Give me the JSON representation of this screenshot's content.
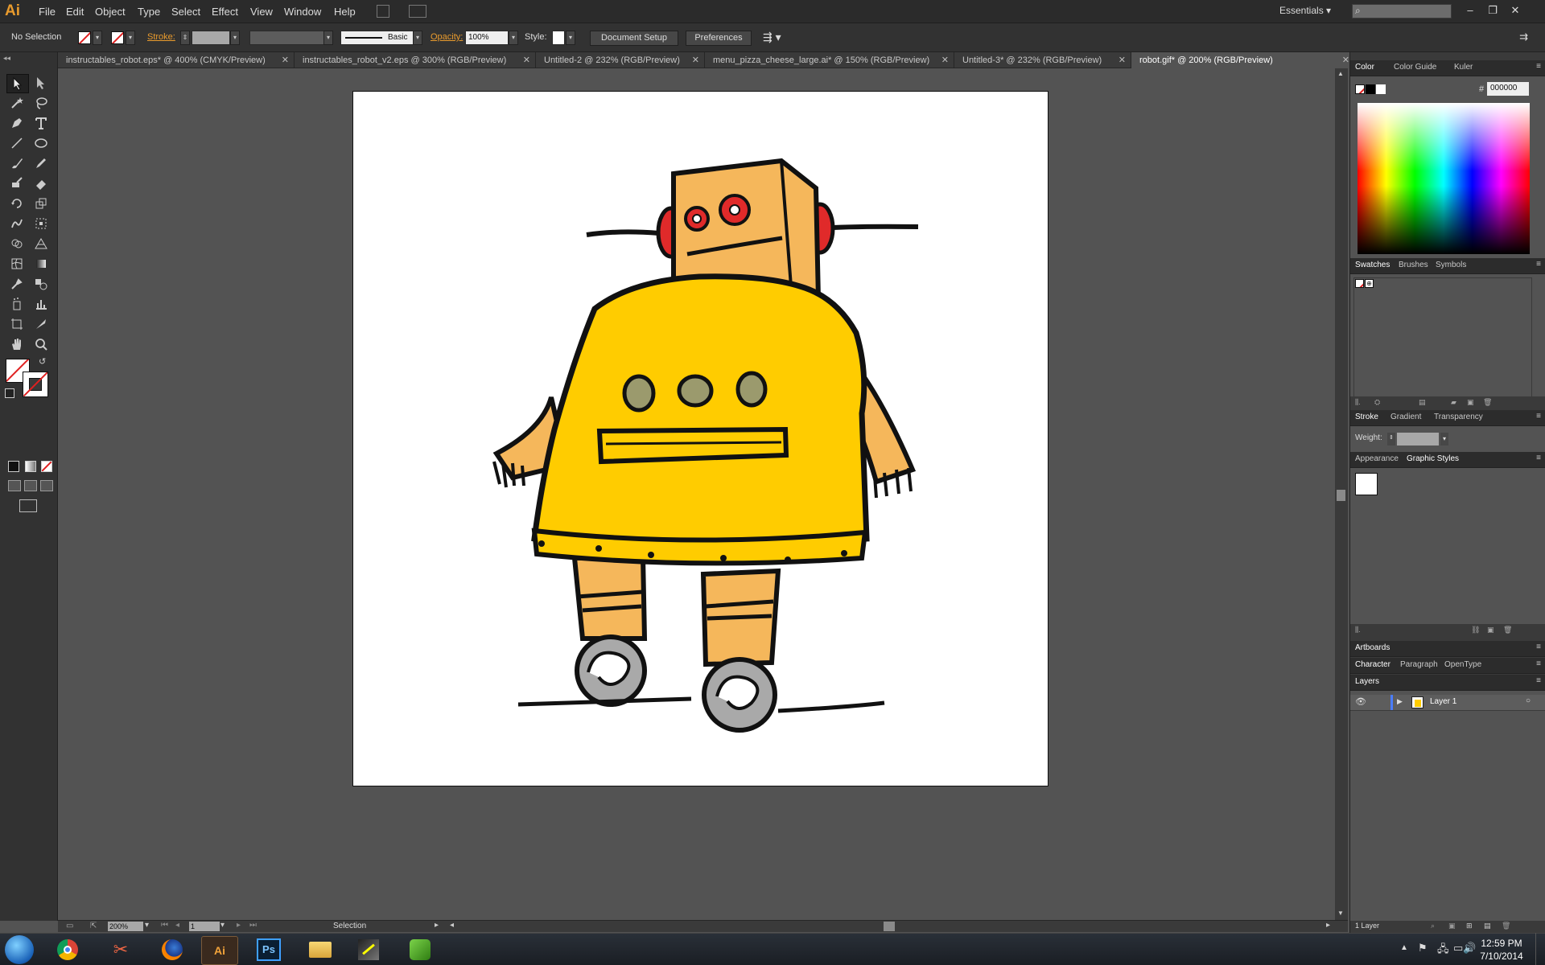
{
  "app": {
    "logo": "Ai",
    "accent": "#e99b2d"
  },
  "menu": [
    "File",
    "Edit",
    "Object",
    "Type",
    "Select",
    "Effect",
    "View",
    "Window",
    "Help"
  ],
  "workspace": "Essentials",
  "control": {
    "selection": "No Selection",
    "stroke_label": "Stroke:",
    "brush": "Basic",
    "opacity_label": "Opacity:",
    "opacity_value": "100%",
    "style_label": "Style:",
    "doc_setup": "Document Setup",
    "preferences": "Preferences"
  },
  "tabs": [
    "instructables_robot.eps* @ 400% (CMYK/Preview)",
    "instructables_robot_v2.eps @ 300% (RGB/Preview)",
    "Untitled-2 @ 232% (RGB/Preview)",
    "menu_pizza_cheese_large.ai* @ 150% (RGB/Preview)",
    "Untitled-3* @ 232% (RGB/Preview)",
    "robot.gif* @ 200% (RGB/Preview)"
  ],
  "status": {
    "zoom": "200%",
    "page": "1",
    "tool": "Selection"
  },
  "panels": {
    "color_tabs": [
      "Color",
      "Color Guide",
      "Kuler"
    ],
    "hex_symbol": "#",
    "hex_value": "000000",
    "swatch_tabs": [
      "Swatches",
      "Brushes",
      "Symbols"
    ],
    "stroke_tabs": [
      "Stroke",
      "Gradient",
      "Transparency"
    ],
    "weight_label": "Weight:",
    "appearance_tabs": [
      "Appearance",
      "Graphic Styles"
    ],
    "artboards": "Artboards",
    "char_tabs": [
      "Character",
      "Paragraph",
      "OpenType"
    ],
    "layers": "Layers",
    "layer_name": "Layer 1",
    "layer_count": "1 Layer"
  },
  "clock": {
    "time": "12:59 PM",
    "date": "7/10/2014"
  },
  "taskbar_apps": [
    "chrome-icon",
    "snip-icon",
    "firefox-icon",
    "illustrator-icon",
    "photoshop-icon",
    "explorer-icon",
    "app-icon",
    "gantt-icon"
  ],
  "taskbar_labels": {
    "ai": "Ai",
    "ps": "Ps"
  },
  "colors": {
    "robot_body": "#ffcc00",
    "robot_limbs": "#f5b75b",
    "robot_ears": "#e02a2a",
    "robot_buttons": "#9b9a6d",
    "wheels": "#a9a9a9"
  }
}
